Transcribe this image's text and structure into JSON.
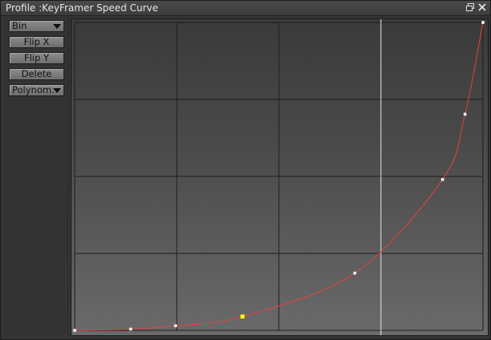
{
  "window": {
    "title": "Profile :KeyFramer Speed Curve",
    "controls": [
      "restore-icon",
      "close-icon"
    ]
  },
  "toolbar": {
    "bin_label": "Bin",
    "flip_x_label": "Flip X",
    "flip_y_label": "Flip Y",
    "delete_label": "Delete",
    "polynom_label": "Polynom."
  },
  "curve": {
    "color": "#e84040",
    "grid_color": "#1e1e1e",
    "cursor_color": "#e6e6e6",
    "selected_key_color": "#ffff00",
    "key_color": "#ffffff",
    "grid_divisions": {
      "x": 4,
      "y": 4
    },
    "cursor_x": 0.75,
    "keys": [
      {
        "x": 0.0,
        "y": 0.0
      },
      {
        "x": 0.137,
        "y": 0.004
      },
      {
        "x": 0.247,
        "y": 0.015
      },
      {
        "x": 0.411,
        "y": 0.045,
        "selected": true
      },
      {
        "x": 0.686,
        "y": 0.186
      },
      {
        "x": 0.901,
        "y": 0.49
      },
      {
        "x": 0.956,
        "y": 0.702
      },
      {
        "x": 1.0,
        "y": 1.0
      }
    ]
  }
}
